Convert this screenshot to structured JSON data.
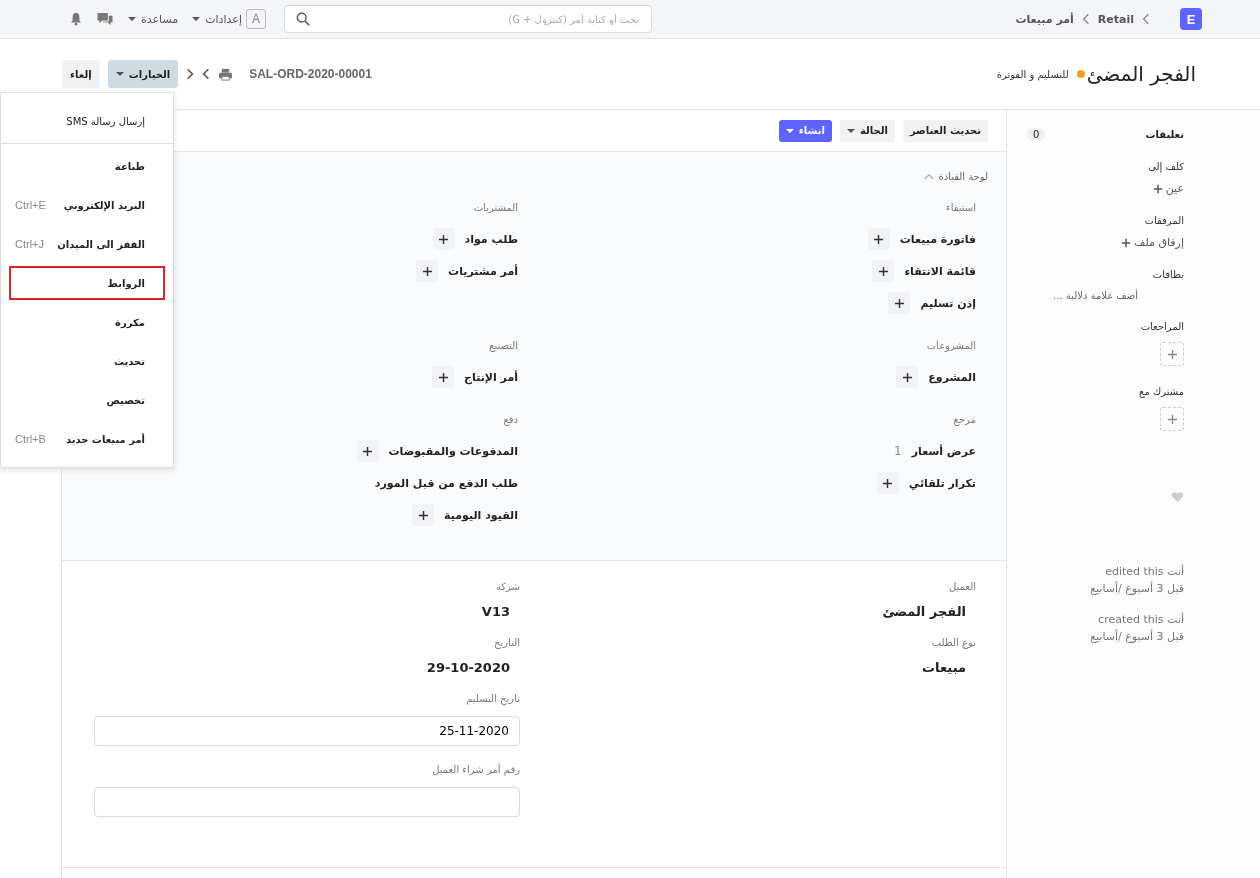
{
  "navbar": {
    "logo": "E",
    "breadcrumbs": [
      "Retail",
      "أمر مبيعات"
    ],
    "search": {
      "placeholder": "بحث أو كتابة أمر (كنترول + G)"
    },
    "avatar": "A",
    "menus": [
      "إعدادات",
      "مساعدة"
    ]
  },
  "header": {
    "title": "الفجر المضئ",
    "status": "للتسليم و الفوترة",
    "doc_id": "SAL-ORD-2020-00001",
    "options_button": {
      "label": "الخيارات",
      "selected": true
    },
    "cancel_button": "إلغاء"
  },
  "options_menu": [
    {
      "label": "إرسال رسالة SMS",
      "divider_after": true,
      "highlighted": false
    },
    {
      "label": "طباعة",
      "divider_after": false,
      "highlighted": false
    },
    {
      "label": "البريد الإلكتروني",
      "shortcut": "Ctrl+E",
      "divider_after": false,
      "highlighted": false
    },
    {
      "label": "القفز الى الميدان",
      "shortcut": "Ctrl+J",
      "divider_after": false,
      "highlighted": false
    },
    {
      "label": "الروابط",
      "divider_after": false,
      "highlighted": true
    },
    {
      "label": "مكررة",
      "divider_after": false,
      "highlighted": false
    },
    {
      "label": "تحديث",
      "divider_after": false,
      "highlighted": false
    },
    {
      "label": "تخصيص",
      "divider_after": false,
      "highlighted": false
    },
    {
      "label": "أمر مبيعات جديد",
      "shortcut": "Ctrl+B",
      "divider_after": false,
      "highlighted": false
    }
  ],
  "toolbar": [
    {
      "label": "تحديث العناصر",
      "kind": "plain"
    },
    {
      "label": "الحالة",
      "kind": "dropdown"
    },
    {
      "label": "انشاء",
      "kind": "primary"
    }
  ],
  "dashboard": {
    "title": "لوحة القيادة",
    "expanded": true,
    "groups": [
      {
        "title": "استيفاء",
        "items": [
          {
            "label": "فاتورة مبيعات",
            "add": true
          },
          {
            "label": "قائمة الانتقاء",
            "add": true
          },
          {
            "label": "إذن تسليم",
            "add": true
          }
        ]
      },
      {
        "title": "المشتريات",
        "items": [
          {
            "label": "طلب مواد",
            "add": true
          },
          {
            "label": "أمر مشتريات",
            "add": true
          }
        ]
      },
      {
        "title": "المشروعات",
        "items": [
          {
            "label": "المشروع",
            "add": true
          }
        ]
      },
      {
        "title": "التصنيع",
        "items": [
          {
            "label": "أمر الإنتاج",
            "add": true
          }
        ]
      },
      {
        "title": "مرجع",
        "items": [
          {
            "label": "عرض أسعار",
            "count": "1",
            "add": false
          },
          {
            "label": "تكرار تلقائي",
            "add": true
          }
        ]
      },
      {
        "title": "دفع",
        "items": [
          {
            "label": "المدفوعات والمقبوضات",
            "add": true
          },
          {
            "label": "طلب الدفع من قبل المورد",
            "add": false
          },
          {
            "label": "القيود اليومية",
            "add": true
          }
        ]
      }
    ]
  },
  "form": {
    "columns": [
      [
        {
          "label": "العميل",
          "value": "الفجر المضئ",
          "kind": "static"
        },
        {
          "label": "نوع الطلب",
          "value": "مبيعات",
          "kind": "static"
        }
      ],
      [
        {
          "label": "شركة",
          "value": "V13",
          "kind": "static"
        },
        {
          "label": "التاريخ",
          "value": "29-10-2020",
          "kind": "static"
        },
        {
          "label": "تاريخ التسليم",
          "value": "25-11-2020",
          "kind": "input"
        },
        {
          "label": "رقم أمر شراء العميل",
          "kind": "input"
        }
      ]
    ]
  },
  "sidebar": {
    "comments": {
      "label": "تعليقات",
      "count": "0"
    },
    "sections": [
      {
        "title": "كلف إلى",
        "kind": "link",
        "action": "عين"
      },
      {
        "title": "المرفقات",
        "kind": "link",
        "action": "إرفاق ملف"
      },
      {
        "title": "بطاقات",
        "kind": "tag",
        "action": "أضف علامة دلالية ..."
      },
      {
        "title": "المراجعات",
        "kind": "box"
      },
      {
        "title": "مشترك مع",
        "kind": "box"
      }
    ],
    "liked": false,
    "activity": [
      {
        "who": "أنت edited this",
        "when": "قبل 3 أسبوع /أسابيع"
      },
      {
        "who": "أنت created this",
        "when": "قبل 3 أسبوع /أسابيع"
      }
    ]
  }
}
